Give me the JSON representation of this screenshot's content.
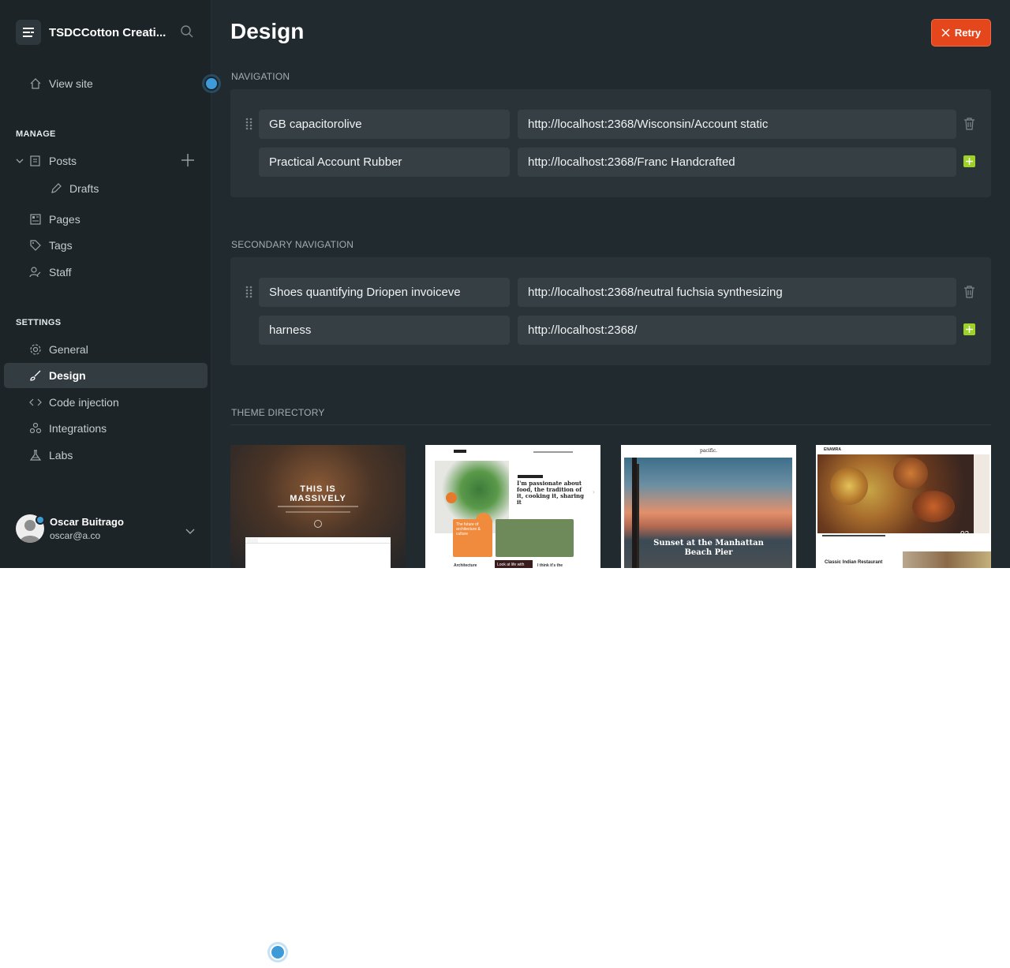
{
  "sidebar": {
    "site_title": "TSDCCotton Creati...",
    "view_site": "View site",
    "manage_label": "MANAGE",
    "settings_label": "SETTINGS",
    "items": {
      "posts": "Posts",
      "drafts": "Drafts",
      "pages": "Pages",
      "tags": "Tags",
      "staff": "Staff",
      "general": "General",
      "design": "Design",
      "code_injection": "Code injection",
      "integrations": "Integrations",
      "labs": "Labs"
    },
    "user": {
      "name": "Oscar Buitrago",
      "email": "oscar@a.co"
    }
  },
  "header": {
    "title": "Design",
    "retry_label": "Retry"
  },
  "navigation": {
    "label": "NAVIGATION",
    "rows": [
      {
        "label": "GB capacitorolive",
        "url": "http://localhost:2368/Wisconsin/Account static"
      },
      {
        "label": "Practical Account Rubber",
        "url": "http://localhost:2368/Franc Handcrafted"
      }
    ]
  },
  "secondary_navigation": {
    "label": "SECONDARY NAVIGATION",
    "rows": [
      {
        "label": "Shoes quantifying Driopen invoiceve",
        "url": "http://localhost:2368/neutral fuchsia synthesizing"
      },
      {
        "label": "harness",
        "url": "http://localhost:2368/"
      }
    ]
  },
  "theme_directory": {
    "label": "THEME DIRECTORY",
    "themes": [
      {
        "heading": "THIS IS MASSIVELY"
      },
      {
        "heading": "I'm passionate about food, the tradition of it, cooking it, sharing it",
        "card1": "The future of architecture & culture",
        "card2": "Architecture",
        "card3": "Look at life with",
        "card4": "I think it's the"
      },
      {
        "brand": "pacific.",
        "heading": "Sunset at the Manhattan Beach Pier"
      },
      {
        "brand": "ENAMRA",
        "heading": "Classic Indian Restaurant",
        "counter": "02"
      }
    ]
  },
  "colors": {
    "accent_red": "#e5461c",
    "add_green": "#9fd229",
    "cursor_blue": "#3e9bd9"
  }
}
